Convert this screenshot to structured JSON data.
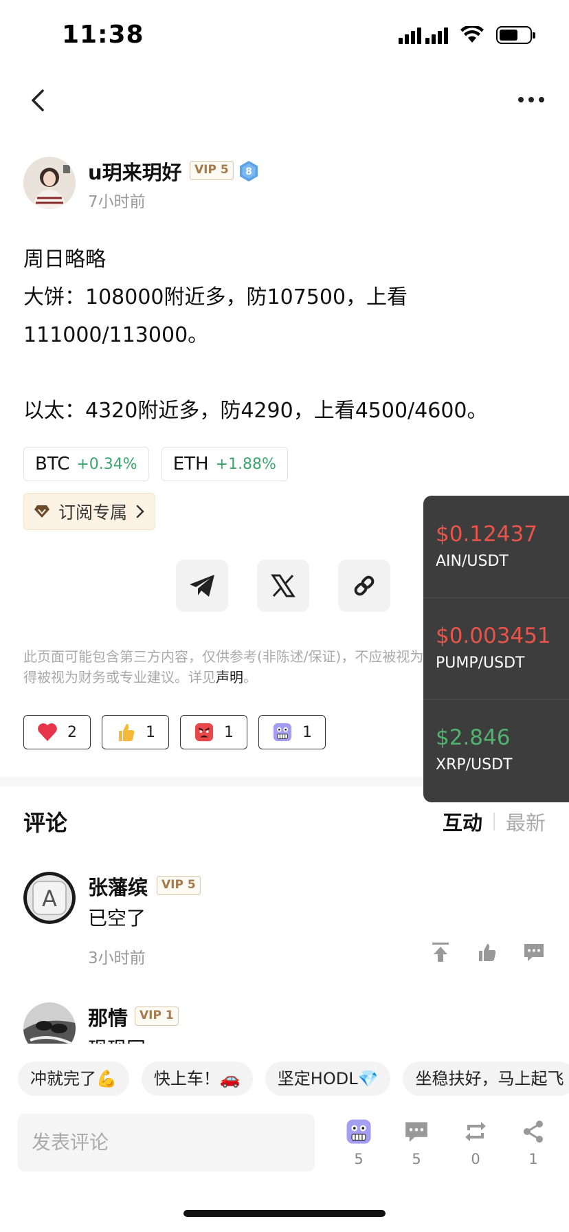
{
  "status_bar": {
    "time": "11:38"
  },
  "author": {
    "name": "u玥来玥好",
    "vip": "VIP 5",
    "level": "8",
    "time": "7小时前"
  },
  "post": {
    "lines": [
      "周日略略",
      "大饼：108000附近多，防107500，上看",
      "111000/113000。",
      "",
      "以太：4320附近多，防4290，上看4500/4600。"
    ]
  },
  "coin_tags": [
    {
      "symbol": "BTC",
      "change": "+0.34%"
    },
    {
      "symbol": "ETH",
      "change": "+1.88%"
    }
  ],
  "subscribe": {
    "label": "订阅专属"
  },
  "disclaimer": {
    "text": "此页面可能包含第三方内容，仅供参考(非陈述/保证)，不应被视为对观点表述，也不得被视为财务或专业建议。详见",
    "link": "声明",
    "end": "。"
  },
  "reactions": [
    {
      "icon": "heart-icon",
      "count": "2"
    },
    {
      "icon": "thumbs-up-icon",
      "count": "1"
    },
    {
      "icon": "angry-face-icon",
      "count": "1"
    },
    {
      "icon": "grimace-face-icon",
      "count": "1"
    }
  ],
  "comments_section": {
    "title": "评论",
    "sort": {
      "active": "互动",
      "other": "最新"
    }
  },
  "comments": [
    {
      "name": "张藩缤",
      "vip": "VIP 5",
      "text": "已空了",
      "time": "3小时前"
    },
    {
      "name": "那情",
      "vip": "VIP 1",
      "text": "现现同"
    }
  ],
  "quick_replies": [
    "冲就完了💪",
    "快上车！🚗",
    "坚定HODL💎",
    "坐稳扶好，马上起飞"
  ],
  "bottom_bar": {
    "placeholder": "发表评论",
    "react_count": "5",
    "comment_count": "5",
    "repost_count": "0",
    "share_count": "1"
  },
  "tickers": [
    {
      "price": "$0.12437",
      "pair": "AIN/USDT",
      "color": "#e8544a"
    },
    {
      "price": "$0.003451",
      "pair": "PUMP/USDT",
      "color": "#e8544a"
    },
    {
      "price": "$2.846",
      "pair": "XRP/USDT",
      "color": "#4fb26d"
    }
  ],
  "colors": {
    "positive": "#3aa56b",
    "negative": "#e8544a",
    "vip": "#a47b4f"
  }
}
